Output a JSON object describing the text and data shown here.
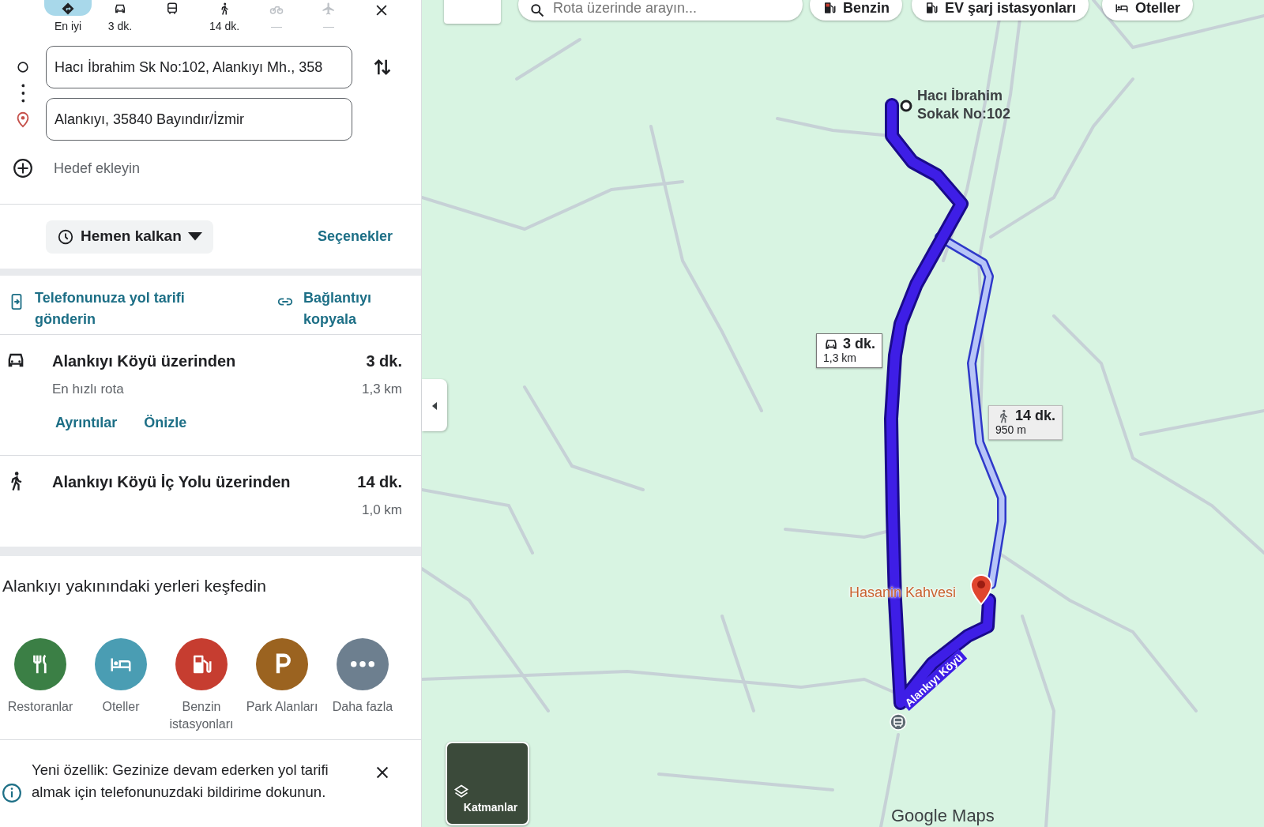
{
  "travel_modes": [
    {
      "kind": "best",
      "label": "En iyi",
      "selected": true,
      "disabled": false
    },
    {
      "kind": "car",
      "label": "3 dk.",
      "selected": false,
      "disabled": false
    },
    {
      "kind": "transit",
      "selected": false,
      "disabled": false
    },
    {
      "kind": "walk",
      "label": "14 dk.",
      "selected": false,
      "disabled": false
    },
    {
      "kind": "bike",
      "label": "—",
      "selected": false,
      "disabled": true
    },
    {
      "kind": "flight",
      "label": "—",
      "selected": false,
      "disabled": true
    }
  ],
  "origin": {
    "value": "Hacı İbrahim Sk No:102, Alankıyı Mh., 358"
  },
  "destination": {
    "value": "Alankıyı, 35840 Bayındır/İzmir"
  },
  "add_destination": {
    "placeholder": "Hedef ekleyin"
  },
  "depart": {
    "label": "Hemen kalkan",
    "options": "Seçenekler"
  },
  "share": [
    {
      "kind": "phone",
      "label": "Telefonunuza yol tarifi gönderin"
    },
    {
      "kind": "link",
      "label": "Bağlantıyı kopyala"
    }
  ],
  "routes": [
    {
      "kind": "car",
      "title": "Alankıyı Köyü üzerinden",
      "subtitle": "En hızlı rota",
      "duration": "3 dk.",
      "distance": "1,3 km",
      "links": [
        "Ayrıntılar",
        "Önizle"
      ]
    },
    {
      "kind": "walk",
      "title": "Alankıyı Köyü İç Yolu üzerinden",
      "duration": "14 dk.",
      "distance": "1,0 km"
    }
  ],
  "explore": {
    "title": "Alankıyı yakınındaki yerleri keşfedin",
    "categories": [
      {
        "kind": "restaurant",
        "label": "Restoranlar",
        "color": "#3b7f45"
      },
      {
        "kind": "hotel",
        "label": "Oteller",
        "color": "#4a9db3"
      },
      {
        "kind": "gas",
        "label": "Benzin istasyonları",
        "color": "#c63d30"
      },
      {
        "kind": "parking",
        "label": "Park Alanları",
        "color": "#9b6320"
      },
      {
        "kind": "more",
        "label": "Daha fazla",
        "color": "#6d7f8f"
      }
    ]
  },
  "notice": {
    "text": "Yeni özellik: Gezinize devam ederken yol tarifi almak için telefonunuzdaki bildirime dokunun."
  },
  "map": {
    "search": {
      "placeholder": "Rota üzerinde arayın..."
    },
    "chips": [
      {
        "kind": "gas",
        "label": "Benzin"
      },
      {
        "kind": "ev",
        "label": "EV şarj istasyonları"
      },
      {
        "kind": "hotel",
        "label": "Oteller"
      }
    ],
    "origin_label": "Hacı İbrahim Sokak No:102",
    "route_labels": [
      {
        "kind": "car",
        "duration": "3 dk.",
        "distance": "1,3 km",
        "selected": true
      },
      {
        "kind": "walk",
        "duration": "14 dk.",
        "distance": "950 m",
        "selected": false
      }
    ],
    "place": "Hasanin Kahvesi",
    "road": "Alankıyı Köyü",
    "layers": "Katmanlar",
    "attribution": "Google Maps"
  }
}
